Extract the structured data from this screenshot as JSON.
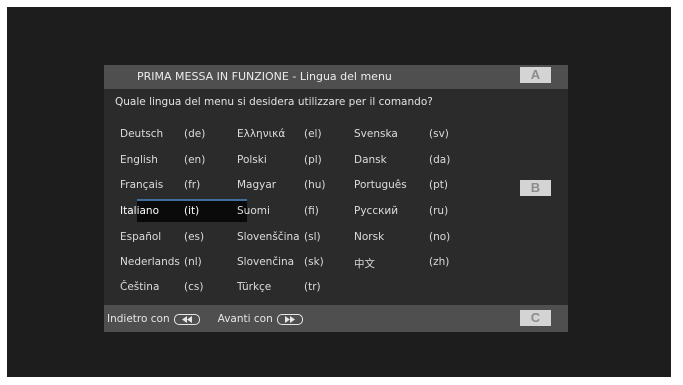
{
  "dialog": {
    "title": "PRIMA MESSA IN FUNZIONE - Lingua del menu",
    "question": "Quale lingua del menu si desidera utilizzare per il comando?"
  },
  "languages": [
    {
      "name": "Deutsch",
      "code": "(de)"
    },
    {
      "name": "English",
      "code": "(en)"
    },
    {
      "name": "Français",
      "code": "(fr)"
    },
    {
      "name": "Italiano",
      "code": "(it)"
    },
    {
      "name": "Español",
      "code": "(es)"
    },
    {
      "name": "Nederlands",
      "code": "(nl)"
    },
    {
      "name": "Čeština",
      "code": "(cs)"
    },
    {
      "name": "Ελληνικά",
      "code": "(el)"
    },
    {
      "name": "Polski",
      "code": "(pl)"
    },
    {
      "name": "Magyar",
      "code": "(hu)"
    },
    {
      "name": "Suomi",
      "code": "(fi)"
    },
    {
      "name": "Slovenščina",
      "code": "(sl)"
    },
    {
      "name": "Slovenčina",
      "code": "(sk)"
    },
    {
      "name": "Türkçe",
      "code": "(tr)"
    },
    {
      "name": "Svenska",
      "code": "(sv)"
    },
    {
      "name": "Dansk",
      "code": "(da)"
    },
    {
      "name": "Português",
      "code": "(pt)"
    },
    {
      "name": "Русский",
      "code": "(ru)"
    },
    {
      "name": "Norsk",
      "code": "(no)"
    },
    {
      "name": "中文",
      "code": "(zh)"
    }
  ],
  "selected_language": "Italiano",
  "footer": {
    "back_label": "Indietro con",
    "back_icon": "rewind-icon",
    "forward_label": "Avanti con",
    "forward_icon": "fast-forward-icon"
  },
  "markers": {
    "a": "A",
    "b": "B",
    "c": "C"
  },
  "colors": {
    "background": "#1d1d1d",
    "dialog": "#2b2b2b",
    "bar": "#4f4f4f",
    "selection_line": "#3f6f9c",
    "marker": "#d4d4d4"
  }
}
